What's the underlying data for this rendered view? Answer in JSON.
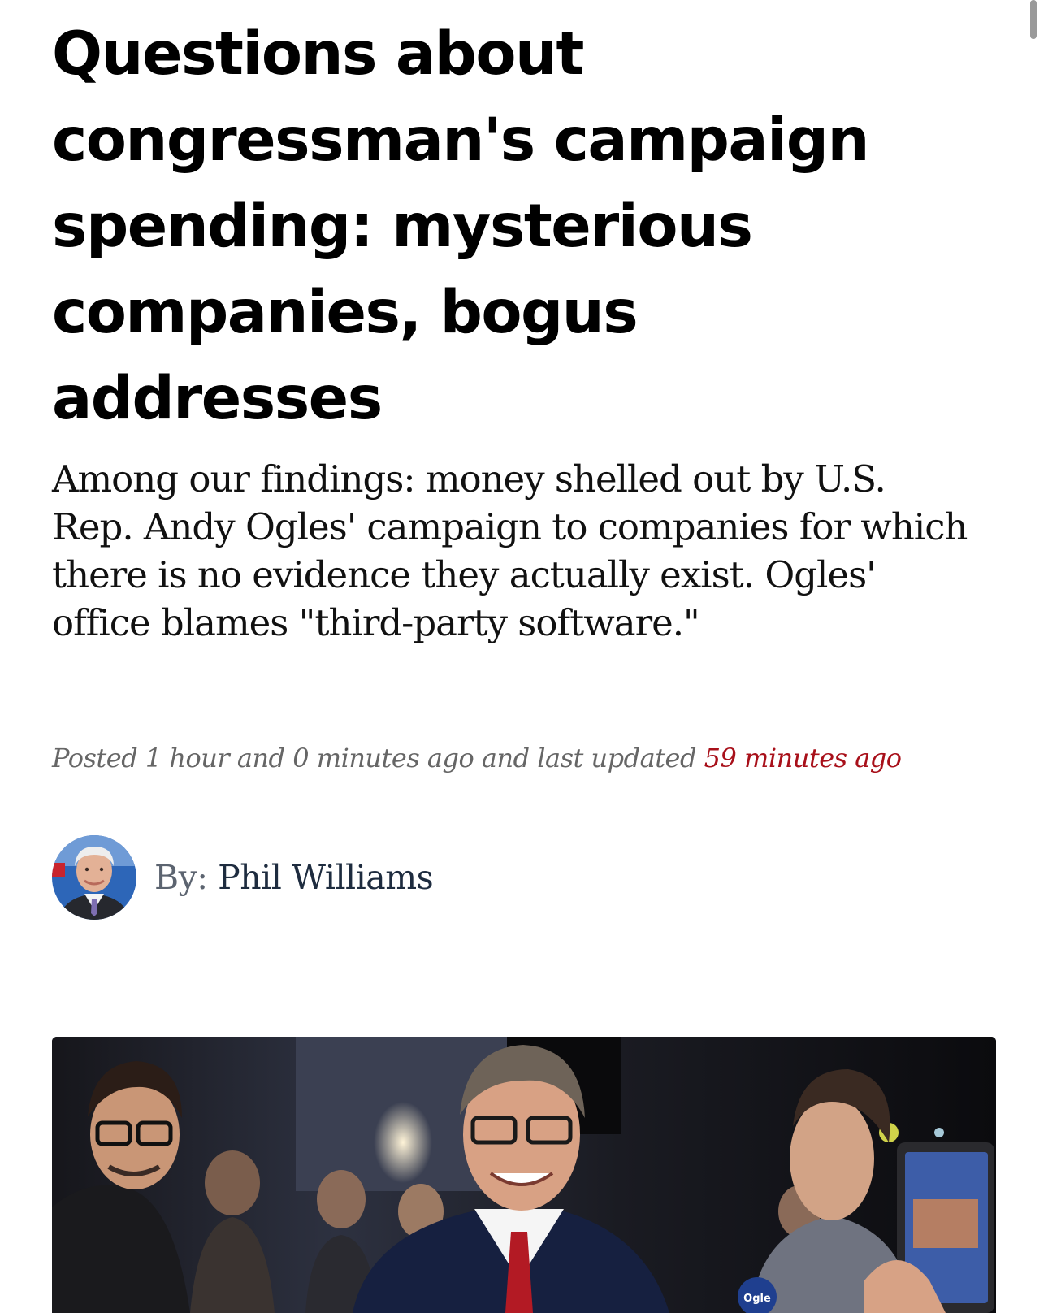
{
  "article": {
    "headline": "Questions about congressman's campaign spending: mysterious companies, bogus addresses",
    "dek": "Among our findings: money shelled out by U.S. Rep. Andy Ogles' campaign to companies for which there is no evidence they actually exist. Ogles' office blames \"third-party software.\"",
    "timestamp": {
      "posted_prefix": "Posted",
      "posted_time": "1 hour and 0 minutes ago",
      "updated_prefix": "and last updated",
      "updated_time": "59 minutes ago"
    },
    "byline": {
      "prefix": "By:",
      "author": "Phil Williams",
      "avatar_icon": "author-photo"
    },
    "hero_image": {
      "description_icon": "news-photo",
      "button_text": "Ogle"
    }
  },
  "colors": {
    "headline": "#000000",
    "dek": "#111111",
    "timestamp": "#666666",
    "accent_red": "#a8101a",
    "byline_author": "#1e2c3f"
  }
}
